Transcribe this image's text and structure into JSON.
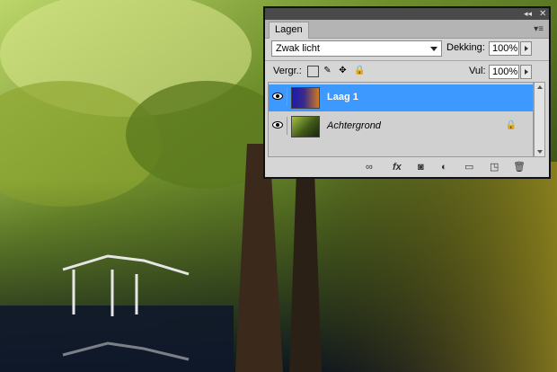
{
  "panel": {
    "tab_label": "Lagen",
    "collapse_glyph": "◂◂",
    "close_glyph": "✕",
    "menu_glyph": "▾≡",
    "blend_mode": "Zwak licht",
    "opacity_label": "Dekking:",
    "opacity_value": "100%",
    "lock_label": "Vergr.:",
    "fill_label": "Vul:",
    "fill_value": "100%"
  },
  "layers": [
    {
      "name": "Laag 1",
      "selected": true,
      "thumbnail": "gradient-blue-orange"
    },
    {
      "name": "Achtergrond",
      "selected": false,
      "thumbnail": "forest-photo",
      "locked": true
    }
  ],
  "bottom_icons": [
    "link-icon",
    "fx-icon",
    "mask-icon",
    "adjustment-icon",
    "folder-icon",
    "new-layer-icon",
    "trash-icon"
  ],
  "bottom_glyphs": {
    "link": "∞",
    "fx": "fx",
    "mask": "◙",
    "adjust": "◐",
    "folder": "▭",
    "new": "◳",
    "trash": "🗑"
  },
  "colors": {
    "selected_row": "#3d98ff",
    "panel_bg": "#d6d6d6"
  }
}
